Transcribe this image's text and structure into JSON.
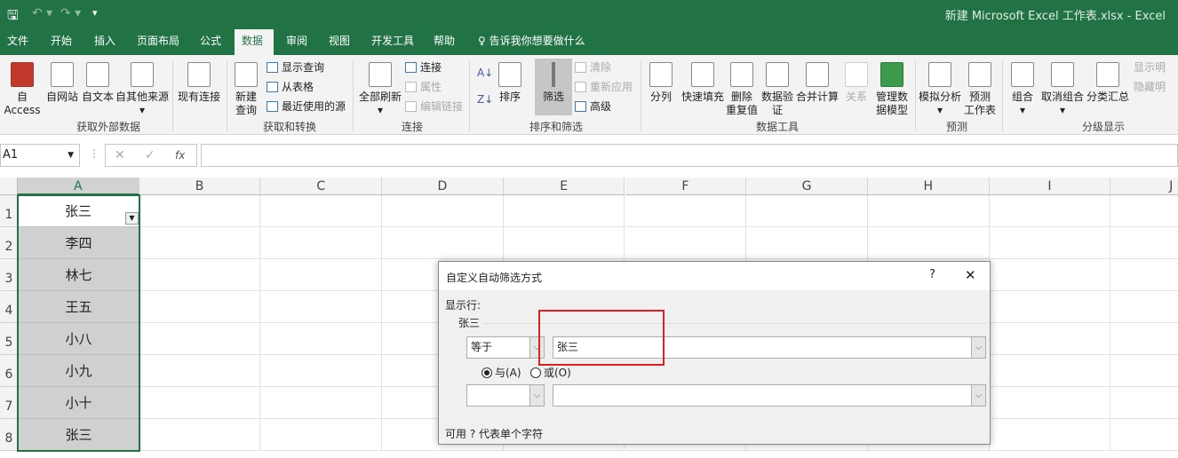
{
  "app": {
    "title": "新建 Microsoft Excel 工作表.xlsx  -  Excel",
    "accent": "#217346"
  },
  "qat": {
    "save": "save-icon",
    "undo": "undo-icon",
    "redo": "redo-icon",
    "customize": "▾"
  },
  "tabs": [
    {
      "label": "文件"
    },
    {
      "label": "开始"
    },
    {
      "label": "插入"
    },
    {
      "label": "页面布局"
    },
    {
      "label": "公式"
    },
    {
      "label": "数据",
      "active": true
    },
    {
      "label": "审阅"
    },
    {
      "label": "视图"
    },
    {
      "label": "开发工具"
    },
    {
      "label": "帮助"
    },
    {
      "label": "告诉我你想要做什么"
    }
  ],
  "ribbon": {
    "get_external": {
      "label": "获取外部数据",
      "items": [
        "自 Access",
        "自网站",
        "自文本",
        "自其他来源",
        "现有连接"
      ]
    },
    "get_transform": {
      "label": "获取和转换",
      "new_query": "新建\n查询",
      "items": [
        "显示查询",
        "从表格",
        "最近使用的源"
      ]
    },
    "connections": {
      "label": "连接",
      "refresh": "全部刷新",
      "items": [
        "连接",
        "属性",
        "编辑链接"
      ]
    },
    "sort_filter": {
      "label": "排序和筛选",
      "sort": "排序",
      "filter": "筛选",
      "items": [
        "清除",
        "重新应用",
        "高级"
      ]
    },
    "data_tools": {
      "label": "数据工具",
      "items": [
        "分列",
        "快速填充",
        "删除\n重复值",
        "数据验\n证",
        "合并计算",
        "关系",
        "管理数\n据模型"
      ]
    },
    "forecast": {
      "label": "预测",
      "items": [
        "模拟分析",
        "预测\n工作表"
      ]
    },
    "outline": {
      "label": "分级显示",
      "items": [
        "组合",
        "取消组合",
        "分类汇总"
      ],
      "small": [
        "显示明",
        "隐藏明"
      ]
    }
  },
  "formula_bar": {
    "name_box": "A1",
    "cancel": "✕",
    "enter": "✓",
    "fx": "fx",
    "value": ""
  },
  "columns": [
    "A",
    "B",
    "C",
    "D",
    "E",
    "F",
    "G",
    "H",
    "I",
    "J"
  ],
  "rows": [
    "1",
    "2",
    "3",
    "4",
    "5",
    "6",
    "7",
    "8"
  ],
  "column_a": [
    "张三",
    "李四",
    "林七",
    "王五",
    "小八",
    "小九",
    "小十",
    "张三"
  ],
  "dialog": {
    "title": "自定义自动筛选方式",
    "help": "?",
    "close": "✕",
    "show_rows": "显示行:",
    "field": "张三",
    "op1": "等于",
    "val1": "张三",
    "and": "与(A)",
    "or": "或(O)",
    "and_selected": true,
    "op2": "",
    "val2": "",
    "hint": "可用 ? 代表单个字符",
    "highlight_color": "#e02020"
  }
}
